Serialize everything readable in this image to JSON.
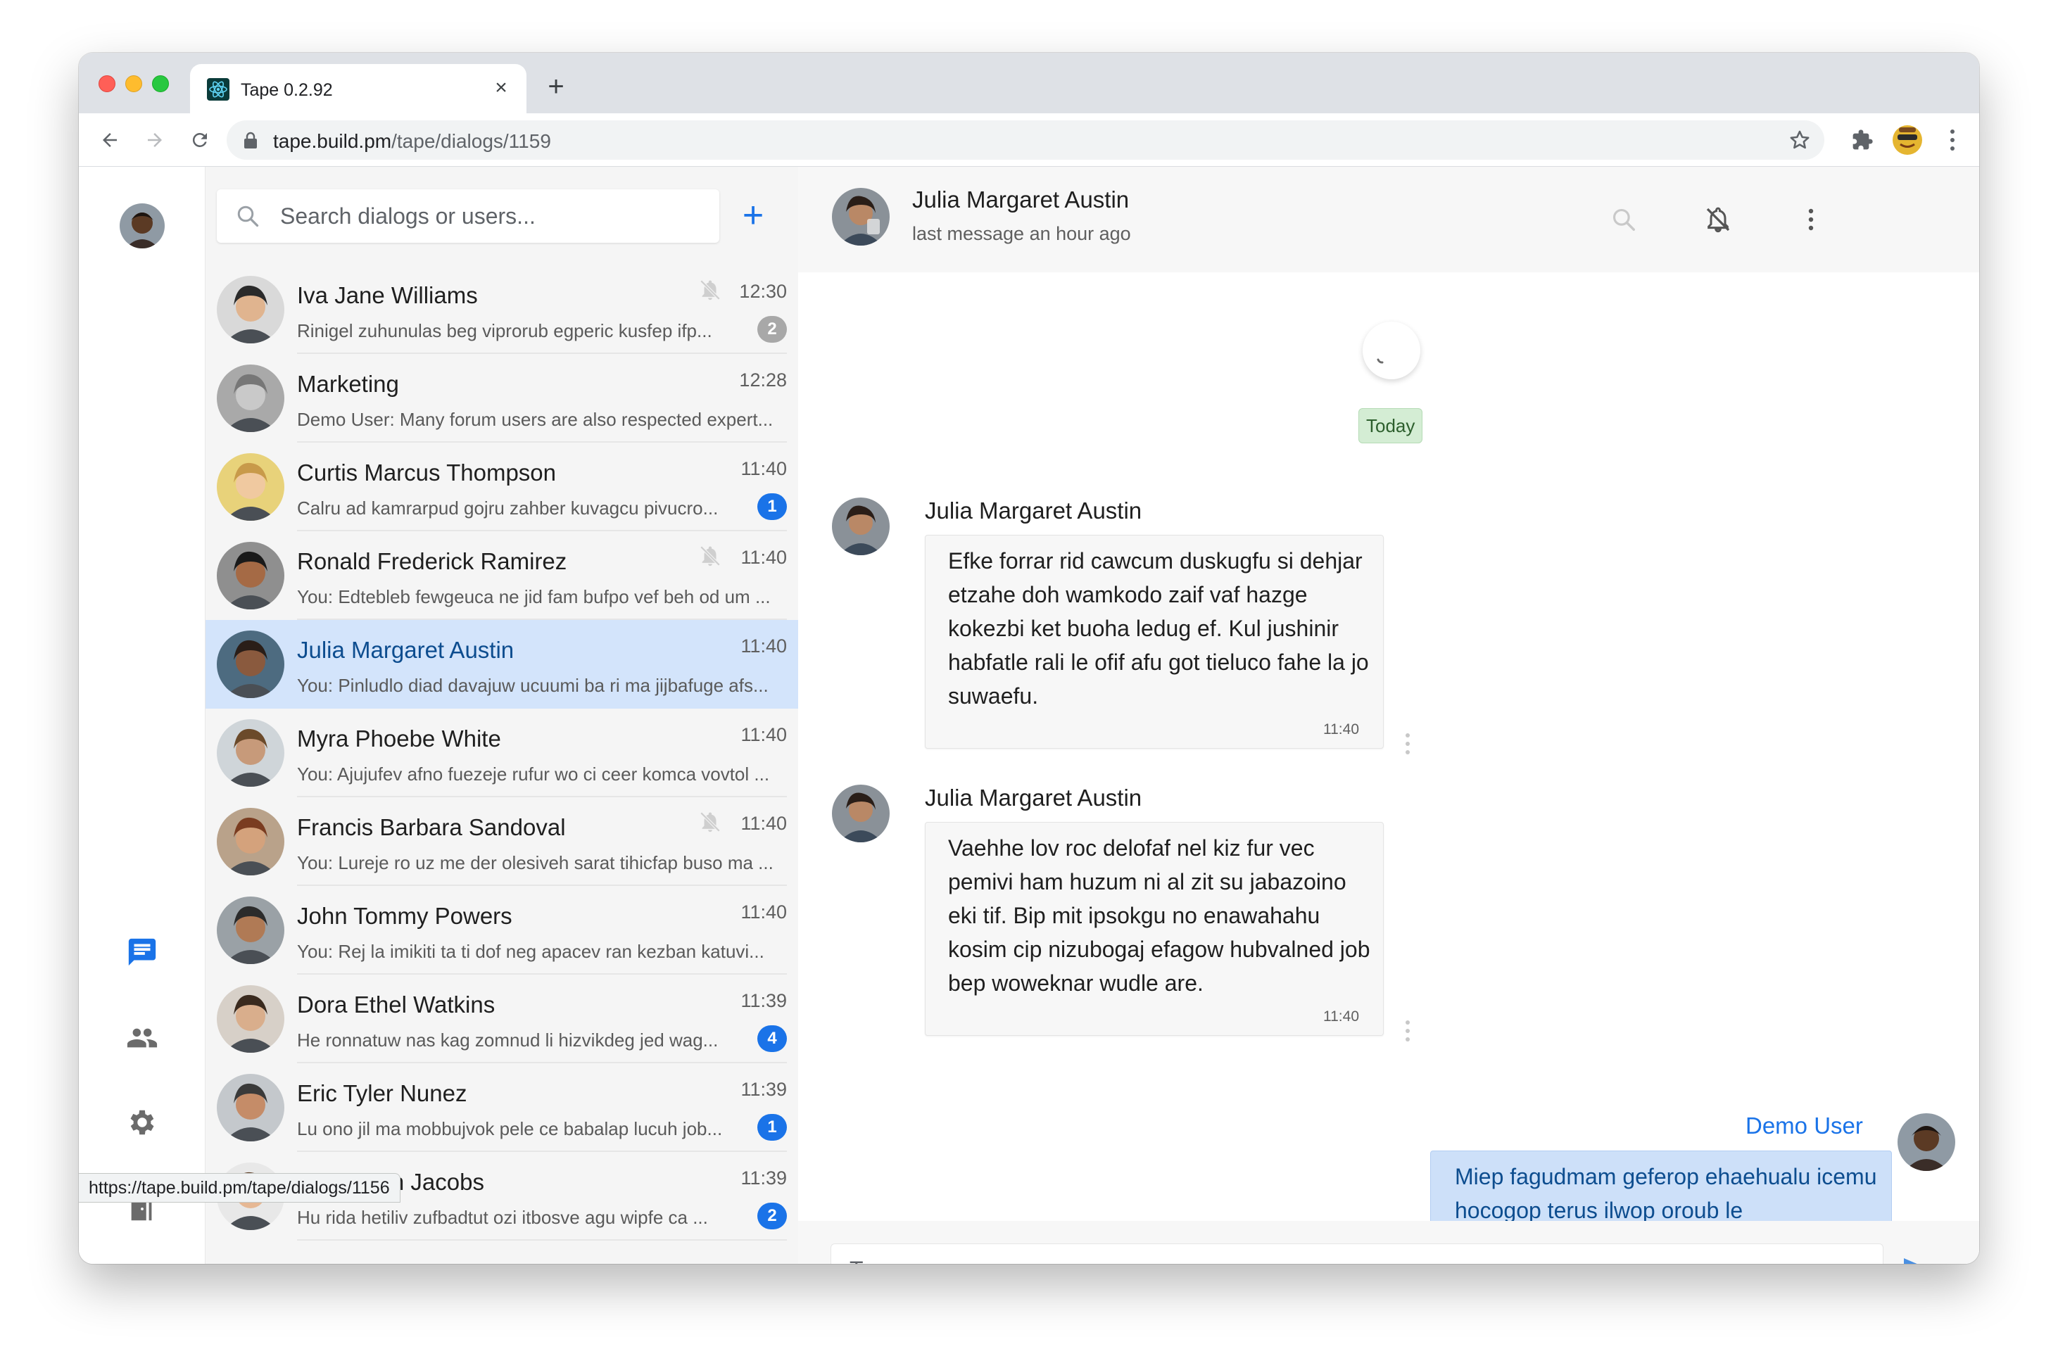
{
  "browser": {
    "tab_title": "Tape 0.2.92",
    "url_host": "tape.build.pm",
    "url_path": "/tape/dialogs/1159",
    "status_url": "https://tape.build.pm/tape/dialogs/1156"
  },
  "sidebar": {
    "search_placeholder": "Search dialogs or users...",
    "dialogs": [
      {
        "name": "Iva Jane Williams",
        "preview": "Rinigel zuhunulas beg viprorub egperic kusfep ifp...",
        "time": "12:30",
        "muted": true,
        "badge": "2",
        "active": false
      },
      {
        "name": "Marketing",
        "preview": "Demo User: Many forum users are also respected expert...",
        "time": "12:28",
        "muted": false,
        "badge": "",
        "active": false
      },
      {
        "name": "Curtis Marcus Thompson",
        "preview": "Calru ad kamrarpud gojru zahber kuvagcu pivucro...",
        "time": "11:40",
        "muted": false,
        "badge": "1",
        "active": false
      },
      {
        "name": "Ronald Frederick Ramirez",
        "preview": "You: Edtebleb fewgeuca ne jid fam bufpo vef beh od um ...",
        "time": "11:40",
        "muted": true,
        "badge": "",
        "active": false
      },
      {
        "name": "Julia Margaret Austin",
        "preview": "You: Pinludlo diad davajuw ucuumi ba ri ma jijbafuge afs...",
        "time": "11:40",
        "muted": false,
        "badge": "",
        "active": true
      },
      {
        "name": "Myra Phoebe White",
        "preview": "You: Ajujufev afno fuezeje rufur wo ci ceer komca vovtol ...",
        "time": "11:40",
        "muted": false,
        "badge": "",
        "active": false
      },
      {
        "name": "Francis Barbara Sandoval",
        "preview": "You: Lureje ro uz me der olesiveh sarat tihicfap buso ma ...",
        "time": "11:40",
        "muted": true,
        "badge": "",
        "active": false
      },
      {
        "name": "John Tommy Powers",
        "preview": "You: Rej la imikiti ta ti dof neg apacev ran kezban katuvi...",
        "time": "11:40",
        "muted": false,
        "badge": "",
        "active": false
      },
      {
        "name": "Dora Ethel Watkins",
        "preview": "He ronnatuw nas kag zomnud li hizvikdeg jed wag...",
        "time": "11:39",
        "muted": false,
        "badge": "4",
        "active": false
      },
      {
        "name": "Eric Tyler Nunez",
        "preview": "Lu ono jil ma mobbujvok pele ce babalap lucuh job...",
        "time": "11:39",
        "muted": false,
        "badge": "1",
        "active": false
      },
      {
        "name": "Kevin Don Jacobs",
        "preview": "Hu rida hetiliv zufbadtut ozi itbosve agu wipfe ca ...",
        "time": "11:39",
        "muted": false,
        "badge": "2",
        "active": false
      }
    ]
  },
  "chat": {
    "title": "Julia Margaret Austin",
    "status": "last message an hour ago",
    "date_chip": "Today",
    "messages": [
      {
        "author": "Julia Margaret Austin",
        "text": "Efke forrar rid cawcum duskugfu si dehjar etzahe doh wamkodo zaif vaf hazge kokezbi ket buoha ledug ef. Kul jushinir habfatle rali le ofif afu got tieluco fahe la jo suwaefu.",
        "time": "11:40"
      },
      {
        "author": "Julia Margaret Austin",
        "text": "Vaehhe lov roc delofaf nel kiz fur vec pemivi ham huzum ni al zit su jabazoino eki tif. Bip mit ipsokgu no enawahahu kosim cip nizubogaj efagow hubvalned job bep woweknar wudle are.",
        "time": "11:40"
      }
    ],
    "own_message": {
      "author": "Demo User",
      "text": "Miep fagudmam geferop ehaehualu icemu hocogop terus ilwop oroub le"
    },
    "composer_placeholder": "Type your message"
  },
  "colors": {
    "accent": "#1a73e8",
    "active_dialog_bg": "#d3e4fb",
    "date_chip_bg": "#d4edd4",
    "own_bubble_bg": "#cde0f9"
  },
  "icons": {
    "rail": [
      "chat-icon",
      "contacts-icon",
      "settings-icon",
      "logout-icon"
    ],
    "chat_header": [
      "search-icon",
      "notifications-off-icon",
      "more-vert-icon"
    ]
  }
}
